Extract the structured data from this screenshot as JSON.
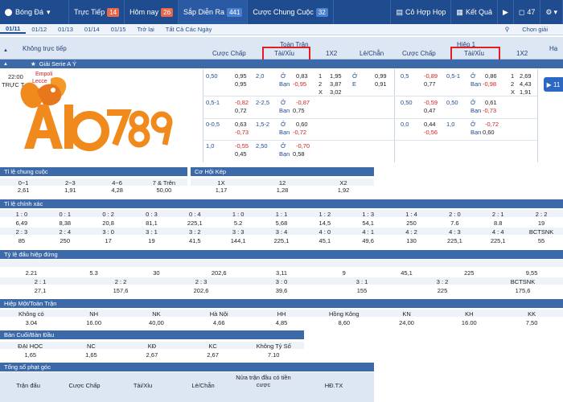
{
  "topnav": {
    "sport": "Bóng Đá",
    "live": "Trực Tiếp",
    "live_count": "14",
    "today": "Hôm nay",
    "today_count": "26",
    "upcoming": "Sắp Diễn Ra",
    "upcoming_count": "441",
    "final": "Cược Chung Cuộc",
    "final_count": "32",
    "combo": "Cỏ Hợp Họp",
    "results": "Kết Quả",
    "notif_count": "47"
  },
  "datebar": {
    "dates": [
      "01/11",
      "01/12",
      "01/13",
      "01/14",
      "01/15",
      "Trở lại",
      "Tất Cả Các Ngày"
    ],
    "chooser": "Chọn giải"
  },
  "header": {
    "live_label": "Không trực tiếp",
    "full_time": "Toàn Trận",
    "half1": "Hiệp 1",
    "handicap": "Cược Chấp",
    "overunder": "Tài/Xỉu",
    "x12": "1X2",
    "oddeven": "Lẻ/Chẵn",
    "handicap2": "Cược Chấp",
    "overunder2": "Tài/Xỉu",
    "x12b": "1X2",
    "more": "Hạ"
  },
  "league": {
    "name": "Giải Serie A Ý"
  },
  "match": {
    "time": "22:00",
    "status": "TRỰC T",
    "home": "Empoli",
    "away": "Lecce",
    "side_count": "11",
    "logo_text": "Alo789",
    "rows": [
      {
        "hc": "0,50",
        "hcv1": "0,95",
        "hcv2": "0,95",
        "ou": "2,0",
        "oul1": "Ở",
        "ouv1": "0,83",
        "oul2": "Bạn",
        "ouv2": "-0,95",
        "x1": "1",
        "x1v": "1,95",
        "x2": "2",
        "x2v": "3,87",
        "xx": "X",
        "xxv": "3,02",
        "oe1": "Ở",
        "oe1v": "0,99",
        "oe2": "E",
        "oe2v": "0,91",
        "h1hc": "0,5",
        "h1v1": "-0,89",
        "h1v2": "0,77",
        "h1ou": "0,5-1",
        "h1l1": "Ở",
        "h1o1": "0,86",
        "h1l2": "Bạn",
        "h1o2": "-0,98",
        "h1x1": "1",
        "h1x1v": "2,69",
        "h1x2": "2",
        "h1x2v": "4,43",
        "h1xx": "X",
        "h1xxv": "1,91"
      },
      {
        "hc": "0,5-1",
        "hcv1": "-0,82",
        "hcv2": "0,72",
        "ou": "2-2,5",
        "oul1": "Ở",
        "ouv1": "-0,87",
        "oul2": "Bạn",
        "ouv2": "0,75",
        "h1hc": "0,50",
        "h1v1": "-0,59",
        "h1v2": "0,47",
        "h1ou": "0,50",
        "h1l1": "Ở",
        "h1o1": "0,61",
        "h1l2": "Bạn",
        "h1o2": "-0,73"
      },
      {
        "hc": "0-0,5",
        "hcv1": "0,63",
        "hcv2": "-0,73",
        "ou": "1,5-2",
        "oul1": "Ở",
        "ouv1": "0,60",
        "oul2": "Bạn",
        "ouv2": "-0,72",
        "h1hc": "0,0",
        "h1v1": "0,44",
        "h1v2": "-0,56",
        "h1ou": "1,0",
        "h1l1": "Ở",
        "h1o1": "-0,72",
        "h1l2": "Bạn",
        "h1o2": "0,60"
      },
      {
        "hc": "1,0",
        "hcv1": "-0,55",
        "hcv2": "0,45",
        "ou": "2,50",
        "oul1": "Ở",
        "ouv1": "-0,70",
        "oul2": "Bạn",
        "ouv2": "0,58"
      }
    ]
  },
  "ti_le_chung_cuoc": {
    "title": "Tỉ lệ chung cuộc",
    "labels": [
      "0~1",
      "2~3",
      "4~6",
      "7 & Trên"
    ],
    "values": [
      "2,61",
      "1,91",
      "4,28",
      "50,00"
    ]
  },
  "co_hoi_kep": {
    "title": "Cơ Hội Kép",
    "labels": [
      "1X",
      "12",
      "X2"
    ],
    "values": [
      "1,17",
      "1,28",
      "1,92"
    ]
  },
  "ti_le_chinh_xac": {
    "title": "Tỉ lệ chính xác",
    "r1_labels": [
      "1 : 0",
      "0 : 1",
      "0 : 2",
      "0 : 3",
      "0 : 4",
      "1 : 0",
      "1 : 1",
      "1 : 2",
      "1 : 3",
      "1 : 4",
      "2 : 0",
      "2 : 1",
      "2 : 2"
    ],
    "r1_values": [
      "6,49",
      "8,38",
      "20,8",
      "81,1",
      "225,1",
      "5.2",
      "5,68",
      "14,5",
      "54,1",
      "250",
      "7.6",
      "8.8",
      "19"
    ],
    "r2_labels": [
      "2 : 3",
      "2 : 4",
      "3 : 0",
      "3 : 1",
      "3 : 2",
      "3 : 3",
      "3 : 4",
      "4 : 0",
      "4 : 1",
      "4 : 2",
      "4 : 3",
      "4 : 4",
      "BCTSNK"
    ],
    "r2_values": [
      "85",
      "250",
      "17",
      "19",
      "41,5",
      "144,1",
      "225,1",
      "45,1",
      "49,6",
      "130",
      "225,1",
      "225,1",
      "55"
    ]
  },
  "ti_le_hiep_dau": {
    "title": "Tỷ lệ đấu hiệp đứng",
    "r1_labels": [
      "0 : 0",
      "0 : 1",
      "0 : 2",
      "0 : 3",
      "1 : 0",
      "1 : 1",
      "1 : 2",
      "2 : 0"
    ],
    "r1_values": [
      "2.21",
      "5.3",
      "30",
      "202,6",
      "3,11",
      "9",
      "45,1",
      "225",
      "9,55"
    ],
    "r2_labels": [
      "2 : 1",
      "2 : 2",
      "2 : 3",
      "3 : 0",
      "3 : 1",
      "3 : 2",
      "BCTSNK"
    ],
    "r2_values": [
      "27,1",
      "157,6",
      "202,6",
      "39,6",
      "155",
      "225",
      "175,6"
    ]
  },
  "hiep_mot": {
    "title": "Hiệp Một/Toàn Trận",
    "labels": [
      "Không có",
      "NH",
      "NK",
      "Hà Nội",
      "HH",
      "Hồng Kông",
      "KN",
      "KH",
      "KK"
    ],
    "values": [
      "3.04",
      "16.00",
      "40,00",
      "4,66",
      "4,85",
      "8,60",
      "24,00",
      "16.00",
      "7,50"
    ]
  },
  "ban_cuoi": {
    "title": "Bàn Cuối/Bàn Đầu",
    "labels": [
      "ĐẠI HỌC",
      "NC",
      "KĐ",
      "KC",
      "Không Tỷ Số"
    ],
    "values": [
      "1,65",
      "1,65",
      "2,67",
      "2,67",
      "7.10"
    ]
  },
  "phat_goc": {
    "title": "Tổng số phạt góc",
    "cols": [
      "Trận đấu",
      "Cược Chấp",
      "Tài/Xỉu",
      "Lẻ/Chẵn",
      "Nửa trận đầu có tiền cược",
      "HĐ.TX"
    ]
  }
}
